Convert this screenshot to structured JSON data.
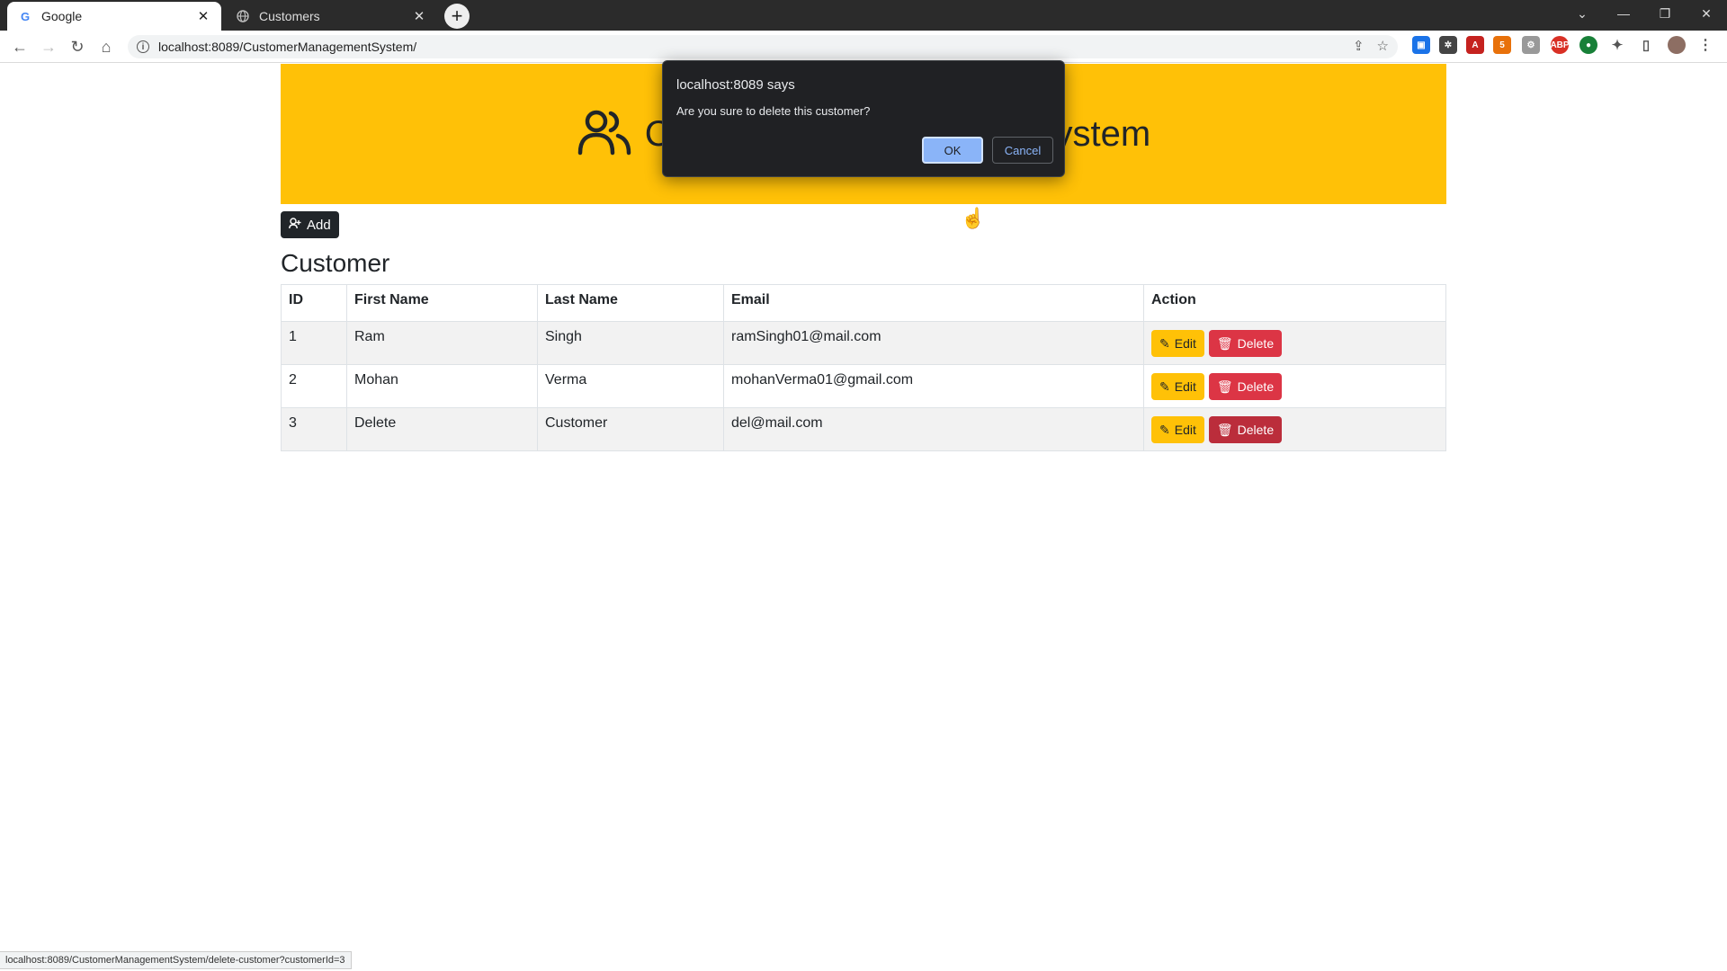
{
  "browser": {
    "tabs": [
      {
        "title": "Google",
        "favicon": "G"
      },
      {
        "title": "Customers",
        "favicon": "globe-icon"
      }
    ],
    "url": "localhost:8089/CustomerManagementSystem/",
    "status_url": "localhost:8089/CustomerManagementSystem/delete-customer?customerId=3"
  },
  "header": {
    "title": "Customer Management System",
    "icon": "users-icon"
  },
  "toolbar": {
    "add_label": "Add"
  },
  "section_title": "Customer",
  "table": {
    "columns": [
      "ID",
      "First Name",
      "Last Name",
      "Email",
      "Action"
    ],
    "rows": [
      {
        "id": "1",
        "first": "Ram",
        "last": "Singh",
        "email": "ramSingh01@mail.com"
      },
      {
        "id": "2",
        "first": "Mohan",
        "last": "Verma",
        "email": "mohanVerma01@gmail.com"
      },
      {
        "id": "3",
        "first": "Delete",
        "last": "Customer",
        "email": "del@mail.com"
      }
    ],
    "edit_label": "Edit",
    "delete_label": "Delete"
  },
  "dialog": {
    "origin": "localhost:8089 says",
    "message": "Are you sure to delete this customer?",
    "ok_label": "OK",
    "cancel_label": "Cancel"
  },
  "colors": {
    "banner": "#ffc107",
    "edit": "#ffc107",
    "delete": "#dc3545",
    "dark": "#212529"
  }
}
